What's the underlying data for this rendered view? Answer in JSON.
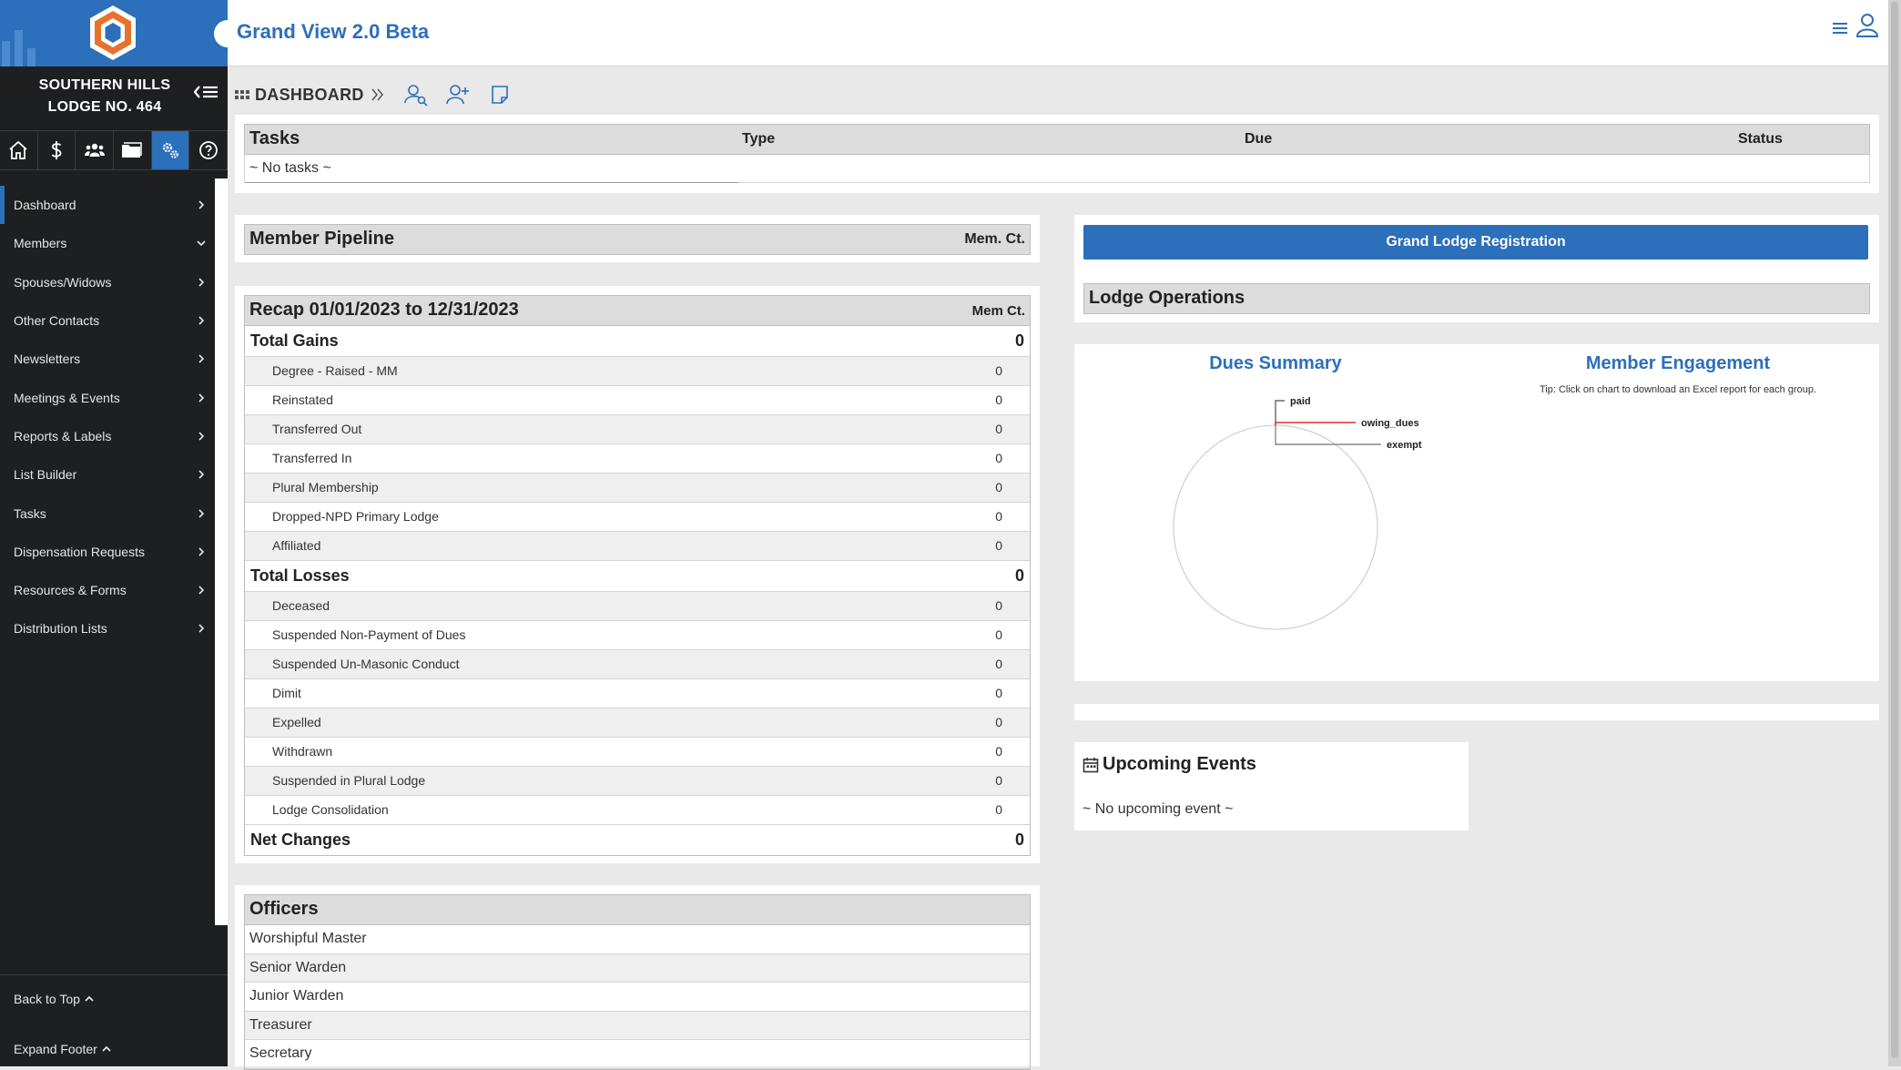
{
  "app": {
    "title": "Grand View 2.0 Beta"
  },
  "lodge": {
    "line1": "SOUTHERN HILLS",
    "line2": "LODGE NO. 464"
  },
  "icon_bar": [
    "home-icon",
    "dollar-icon",
    "members-icon",
    "folder-icon",
    "settings-icon",
    "help-icon"
  ],
  "nav": {
    "items": [
      {
        "label": "Dashboard",
        "chevron": "right"
      },
      {
        "label": "Members",
        "chevron": "down"
      },
      {
        "label": "Spouses/Widows",
        "chevron": "right"
      },
      {
        "label": "Other Contacts",
        "chevron": "right"
      },
      {
        "label": "Newsletters",
        "chevron": "right"
      },
      {
        "label": "Meetings & Events",
        "chevron": "right"
      },
      {
        "label": "Reports & Labels",
        "chevron": "right"
      },
      {
        "label": "List Builder",
        "chevron": "right"
      },
      {
        "label": "Tasks",
        "chevron": "right"
      },
      {
        "label": "Dispensation Requests",
        "chevron": "right"
      },
      {
        "label": "Resources & Forms",
        "chevron": "right"
      },
      {
        "label": "Distribution Lists",
        "chevron": "right"
      }
    ],
    "back_to_top": "Back to Top",
    "expand_footer": "Expand Footer"
  },
  "breadcrumb": {
    "current": "DASHBOARD"
  },
  "tasks": {
    "title": "Tasks",
    "col_type": "Type",
    "col_due": "Due",
    "col_status": "Status",
    "empty": "~ No tasks ~"
  },
  "pipeline": {
    "title": "Member Pipeline",
    "col": "Mem. Ct."
  },
  "recap": {
    "title": "Recap 01/01/2023 to 12/31/2023",
    "col": "Mem Ct.",
    "gains_label": "Total Gains",
    "gains_total": "0",
    "gains": [
      {
        "label": "Degree - Raised - MM",
        "value": "0"
      },
      {
        "label": "Reinstated",
        "value": "0"
      },
      {
        "label": "Transferred Out",
        "value": "0"
      },
      {
        "label": "Transferred In",
        "value": "0"
      },
      {
        "label": "Plural Membership",
        "value": "0"
      },
      {
        "label": "Dropped-NPD Primary Lodge",
        "value": "0"
      },
      {
        "label": "Affiliated",
        "value": "0"
      }
    ],
    "losses_label": "Total Losses",
    "losses_total": "0",
    "losses": [
      {
        "label": "Deceased",
        "value": "0"
      },
      {
        "label": "Suspended Non-Payment of Dues",
        "value": "0"
      },
      {
        "label": "Suspended Un-Masonic Conduct",
        "value": "0"
      },
      {
        "label": "Dimit",
        "value": "0"
      },
      {
        "label": "Expelled",
        "value": "0"
      },
      {
        "label": "Withdrawn",
        "value": "0"
      },
      {
        "label": "Suspended in Plural Lodge",
        "value": "0"
      },
      {
        "label": "Lodge Consolidation",
        "value": "0"
      }
    ],
    "net_label": "Net Changes",
    "net_total": "0"
  },
  "officers": {
    "title": "Officers",
    "items": [
      "Worshipful Master",
      "Senior Warden",
      "Junior Warden",
      "Treasurer",
      "Secretary"
    ]
  },
  "grand_lodge_button": "Grand Lodge Registration",
  "lodge_operations": {
    "title": "Lodge Operations"
  },
  "dues_summary": {
    "title": "Dues Summary"
  },
  "engagement": {
    "title": "Member Engagement",
    "tip": "Tip: Click on chart to download an Excel report for each group."
  },
  "chart_data": {
    "type": "pie",
    "title": "Dues Summary",
    "categories": [
      "paid",
      "owing_dues",
      "exempt"
    ],
    "values": [
      0,
      0,
      0
    ],
    "colors": [
      "#666666",
      "#e03030",
      "#888888"
    ]
  },
  "upcoming_events": {
    "title": "Upcoming Events",
    "empty": "~ No upcoming event ~"
  }
}
